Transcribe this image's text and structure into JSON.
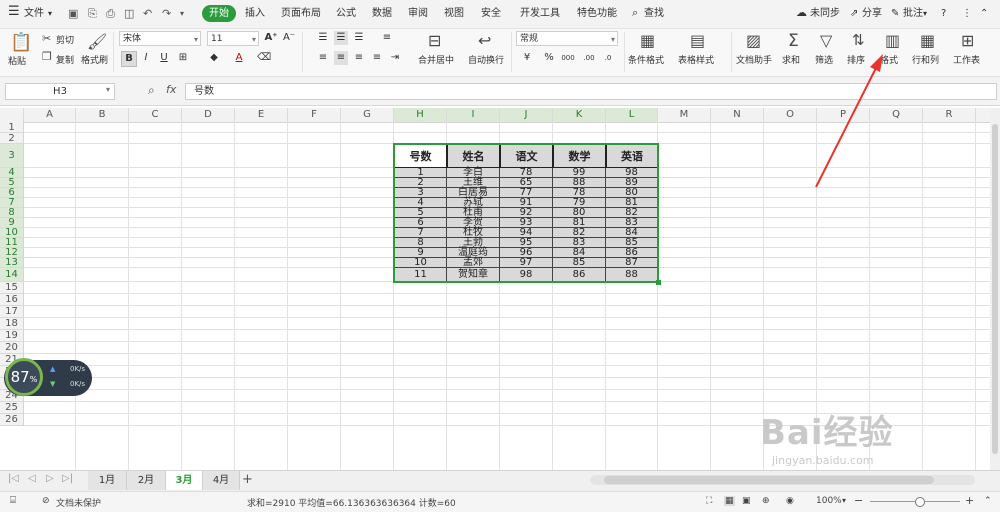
{
  "menubar": {
    "file": "文件",
    "tabs": [
      "开始",
      "插入",
      "页面布局",
      "公式",
      "数据",
      "审阅",
      "视图",
      "安全",
      "开发工具",
      "特色功能"
    ],
    "search": "查找",
    "sync": "未同步",
    "share": "分享",
    "comment": "批注",
    "help": "?"
  },
  "ribbon": {
    "paste": "粘贴",
    "cut": "剪切",
    "copy": "复制",
    "format_painter": "格式刷",
    "font_name": "宋体",
    "font_size": "11",
    "merge_center": "合并居中",
    "auto_wrap": "自动换行",
    "number_format": "常规",
    "conditional_format": "条件格式",
    "table_style": "表格样式",
    "doc_helper": "文档助手",
    "sum": "求和",
    "filter": "筛选",
    "sort": "排序",
    "format": "格式",
    "row_col": "行和列",
    "worksheet": "工作表"
  },
  "formulabar": {
    "namebox": "H3",
    "fx": "fx",
    "content": "号数"
  },
  "columns": [
    "A",
    "B",
    "C",
    "D",
    "E",
    "F",
    "G",
    "H",
    "I",
    "J",
    "K",
    "L",
    "M",
    "N",
    "O",
    "P",
    "Q",
    "R"
  ],
  "rows": [
    "1",
    "2",
    "3",
    "4",
    "5",
    "6",
    "7",
    "8",
    "9",
    "10",
    "11",
    "12",
    "13",
    "14",
    "15",
    "16",
    "17",
    "18",
    "19",
    "20",
    "21",
    "22",
    "23",
    "24",
    "25",
    "26"
  ],
  "table": {
    "headers": [
      "号数",
      "姓名",
      "语文",
      "数学",
      "英语"
    ],
    "rows": [
      [
        "1",
        "李白",
        "78",
        "99",
        "98"
      ],
      [
        "2",
        "王维",
        "65",
        "88",
        "89"
      ],
      [
        "3",
        "白居易",
        "77",
        "78",
        "80"
      ],
      [
        "4",
        "苏轼",
        "91",
        "79",
        "81"
      ],
      [
        "5",
        "杜甫",
        "92",
        "80",
        "82"
      ],
      [
        "6",
        "李贺",
        "93",
        "81",
        "83"
      ],
      [
        "7",
        "杜牧",
        "94",
        "82",
        "84"
      ],
      [
        "8",
        "王勃",
        "95",
        "83",
        "85"
      ],
      [
        "9",
        "温庭筠",
        "96",
        "84",
        "86"
      ],
      [
        "10",
        "孟郊",
        "97",
        "85",
        "87"
      ],
      [
        "11",
        "贺知章",
        "98",
        "86",
        "88"
      ]
    ]
  },
  "sheets": [
    "1月",
    "2月",
    "3月",
    "4月"
  ],
  "active_sheet": "3月",
  "statusbar": {
    "protect": "文档未保护",
    "stats": "求和=2910  平均值=66.136363636364  计数=60",
    "zoom": "100%"
  },
  "widget": {
    "percent": "87",
    "percent_sign": "%",
    "up": "0K/s",
    "down": "0K/s"
  },
  "watermark": {
    "text": "Bai经验",
    "url": "jingyan.baidu.com"
  },
  "colors": {
    "accent": "#2a9c3d",
    "arrow": "#e8342b"
  }
}
